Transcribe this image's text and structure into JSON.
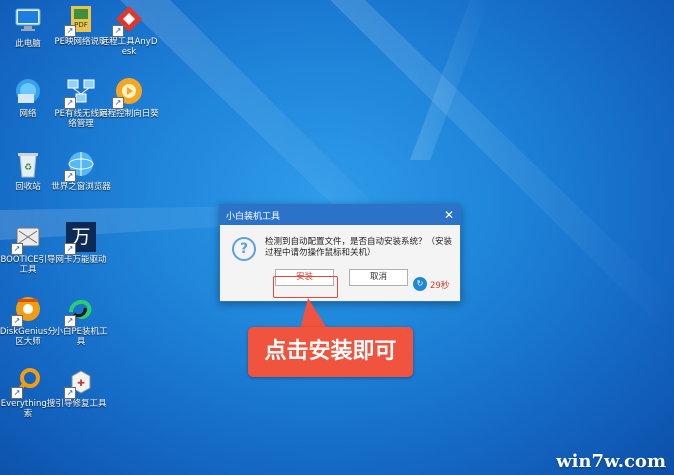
{
  "desktop": {
    "icons": [
      {
        "label": "此电脑",
        "icon": "computer-icon"
      },
      {
        "label": "PE映网络说明",
        "icon": "pdf-icon"
      },
      {
        "label": "远程工具AnyDesk",
        "icon": "anydesk-icon"
      },
      {
        "label": "网络",
        "icon": "network-icon"
      },
      {
        "label": "PE有线无线网络管理",
        "icon": "network-manager-icon"
      },
      {
        "label": "远程控制向日葵",
        "icon": "sunflower-icon"
      },
      {
        "label": "回收站",
        "icon": "recycle-bin-icon"
      },
      {
        "label": "世界之窗浏览器",
        "icon": "browser-icon"
      },
      {
        "label": "BOOTICE引导工具",
        "icon": "bootice-icon"
      },
      {
        "label": "网卡万能驱动",
        "icon": "wan-driver-icon"
      },
      {
        "label": "DiskGenius分区大师",
        "icon": "diskgenius-icon"
      },
      {
        "label": "小白PE装机工具",
        "icon": "xiaobai-icon"
      },
      {
        "label": "Everything搜索",
        "icon": "everything-icon"
      },
      {
        "label": "引导修复工具",
        "icon": "repair-tool-icon"
      }
    ]
  },
  "dialog": {
    "title": "小白装机工具",
    "close": "✕",
    "message": "检测到自动配置文件，是否自动安装系统？（安装过程中请勿操作鼠标和关机）",
    "install_label": "安装",
    "cancel_label": "取消",
    "countdown": "29秒"
  },
  "annotation": {
    "text": "点击安装即可"
  },
  "watermark": "win7w.com",
  "colors": {
    "accent": "#2b73c9",
    "callout": "#f0533e"
  }
}
